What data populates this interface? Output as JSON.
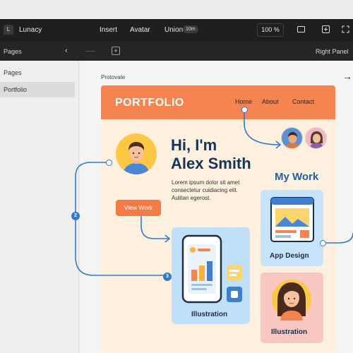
{
  "topbar": {
    "logo_letter": "L",
    "app_title": "Lunacy",
    "menu": [
      "Insert",
      "Avatar",
      "Union"
    ],
    "union_badge": "10m",
    "zoom": "100 %"
  },
  "subbar": {
    "pages_label": "Pages",
    "right_panel": "Right Panel"
  },
  "left_panel": {
    "header": "Pages",
    "selected_page": "Portfolio"
  },
  "canvas": {
    "frame_label": "Protovate"
  },
  "site": {
    "brand": "PORTFOLIO",
    "nav": [
      "Home",
      "About",
      "Contact"
    ],
    "greeting": "Hi, I'm",
    "name": "Alex Smith",
    "lorem_lines": [
      "Lorem ipsum dolor sit amet",
      "consectetur cuidiacing elit.",
      "Aulitan egerost."
    ],
    "cta": "View Work",
    "section_title": "My Work",
    "cards": [
      {
        "title": "Illustration"
      },
      {
        "title": "App Design"
      },
      {
        "title": "Illustration"
      }
    ]
  },
  "flow": {
    "badges": [
      "2",
      "3"
    ]
  },
  "colors": {
    "header_orange": "#f58451",
    "frame_bg": "#fdf0de",
    "link_blue": "#2f7bd0",
    "heading_navy": "#17345a"
  }
}
